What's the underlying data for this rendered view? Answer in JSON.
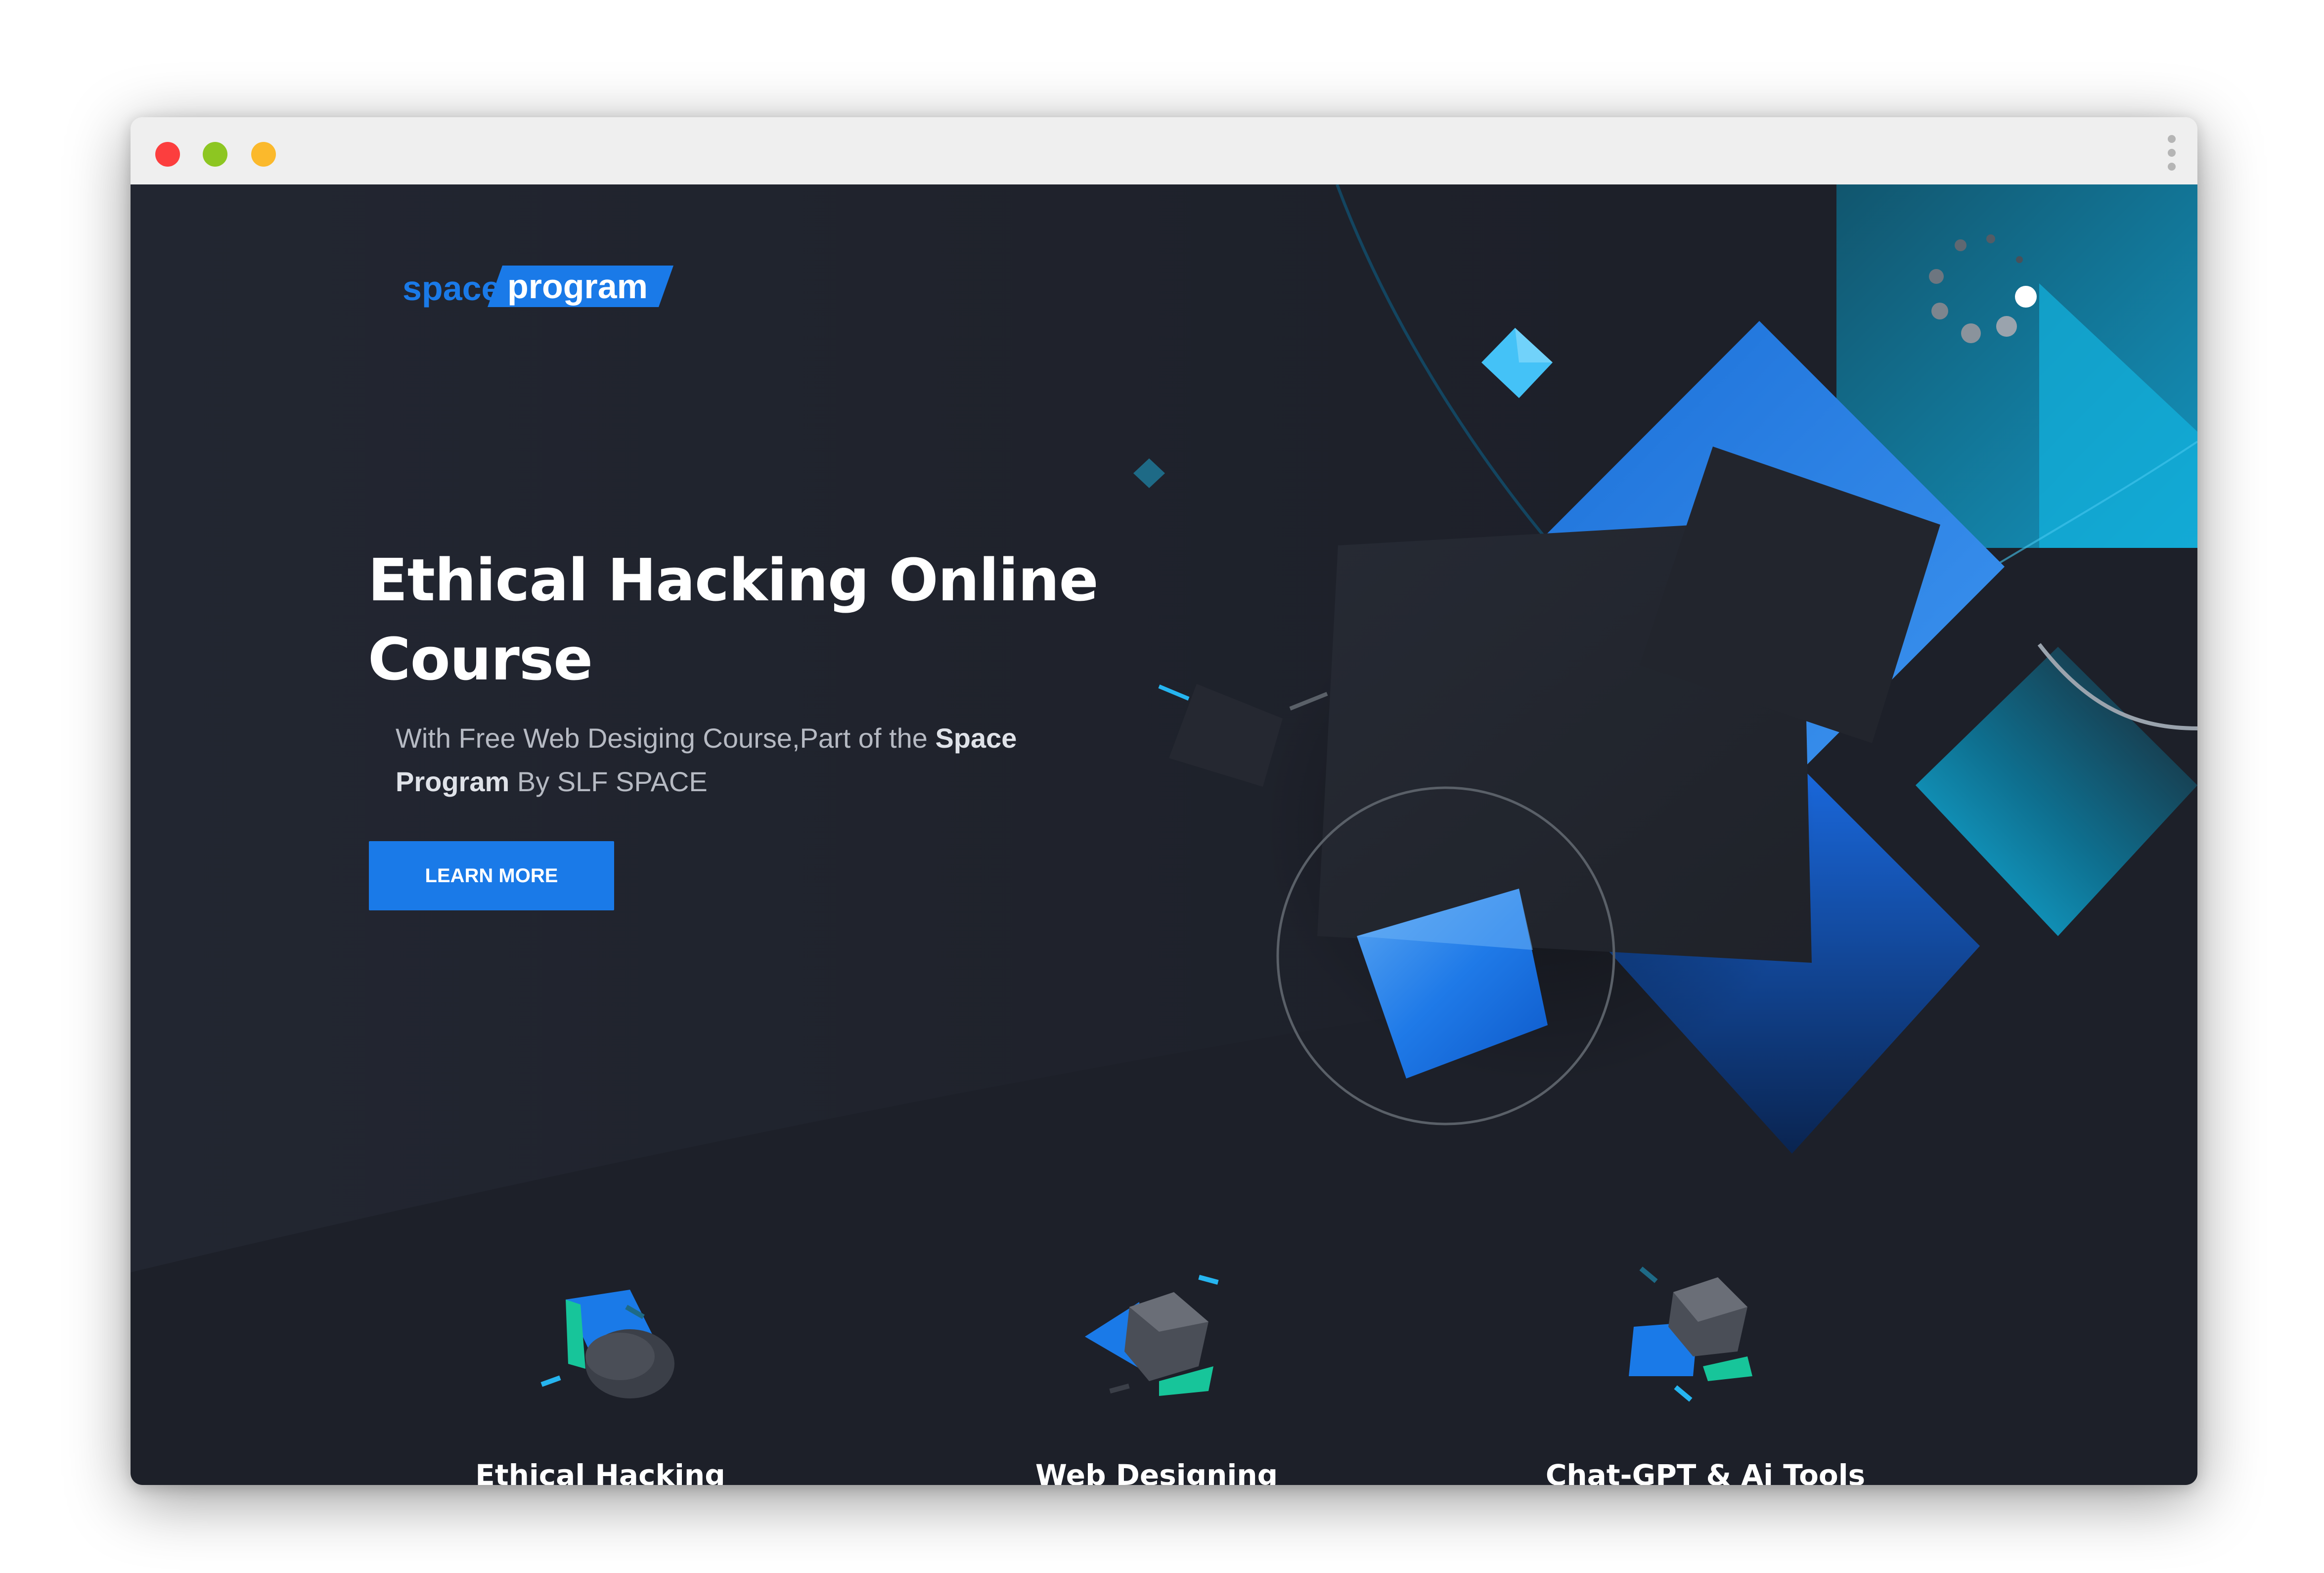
{
  "window": {
    "controls": [
      "close",
      "minimize",
      "maximize"
    ],
    "menu_icon": "kebab-menu-icon"
  },
  "brand": {
    "logo_part1": "space",
    "logo_part2": "program",
    "accent": "#1a7ae8",
    "background": "#1d2029"
  },
  "hero": {
    "title_line1": "Ethical Hacking Online",
    "title_line2": "Course",
    "subtitle_pre": "With Free Web Desiging Course,Part of the ",
    "subtitle_bold1": "Space",
    "subtitle_bold2": "Program",
    "subtitle_post": " By SLF SPACE",
    "cta_label": "LEARN MORE"
  },
  "features": [
    {
      "title": "Ethical Hacking",
      "icon": "cylinder-cube-icon"
    },
    {
      "title": "Web Designing",
      "icon": "cube-arrow-icon"
    },
    {
      "title": "Chat-GPT & Ai Tools",
      "icon": "hexagon-cube-icon"
    }
  ]
}
